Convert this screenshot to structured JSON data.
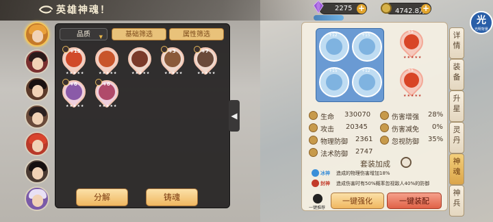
{
  "header": {
    "title": "英雄神魂！"
  },
  "resources": {
    "gem": {
      "value": "2275",
      "icon": "purple-gem-icon"
    },
    "gold": {
      "value": "4742.8万",
      "icon": "gold-coin-icon"
    }
  },
  "corner_badge": {
    "main": "光",
    "sub": "光明背景"
  },
  "filters": {
    "quality": "品质",
    "base": "基础筛选",
    "attribute": "属性筛选"
  },
  "inventory": [
    {
      "level": "+15",
      "stars": "★★★★★"
    },
    {
      "level": "",
      "stars": "★★★★★"
    },
    {
      "level": "",
      "stars": "★★★★★"
    },
    {
      "level": "+3",
      "stars": "★★★★★"
    },
    {
      "level": "+7",
      "stars": "★★★★★"
    },
    {
      "level": "+6",
      "stars": "★★★★★"
    },
    {
      "level": "+6",
      "stars": "★★★★★"
    }
  ],
  "actions": {
    "decompose": "分解",
    "forge": "铸魂",
    "one_click_enhance": "一键强化",
    "one_click_equip": "一键装配",
    "recommend": "一键推荐"
  },
  "equipped": {
    "ice": [
      {
        "tag": "+12"
      },
      {
        "tag": "+15"
      },
      {
        "tag": "+15"
      },
      {
        "tag": "+12"
      }
    ],
    "fire": [
      {
        "tag": "+5",
        "stars": "★★★★★"
      },
      {
        "tag": "+5",
        "stars": "★★★★★"
      }
    ]
  },
  "stats": [
    {
      "label": "生命",
      "value": "330070"
    },
    {
      "label": "伤害增强",
      "value": "28%"
    },
    {
      "label": "攻击",
      "value": "20345"
    },
    {
      "label": "伤害减免",
      "value": "0%"
    },
    {
      "label": "物理防御",
      "value": "2361"
    },
    {
      "label": "忽视防御",
      "value": "35%"
    },
    {
      "label": "法术防御",
      "value": "2747"
    }
  ],
  "set_bonus": {
    "title": "套装加成",
    "items": [
      {
        "name": "冰神",
        "desc": "造成的物理伤害增加18%",
        "color": "#3a8fd8"
      },
      {
        "name": "封神",
        "desc": "造成伤害时有50%概率忽视敌人40%的防御",
        "color": "#c23b2a"
      }
    ]
  },
  "tabs": [
    "详情",
    "装备",
    "升星",
    "灵丹",
    "神魂",
    "神兵"
  ],
  "active_tab": "神魂",
  "colors": {
    "accent_gold": "#f0b760",
    "accent_red": "#e06247",
    "panel_dark": "#242222",
    "panel_light": "#f4eee2"
  }
}
